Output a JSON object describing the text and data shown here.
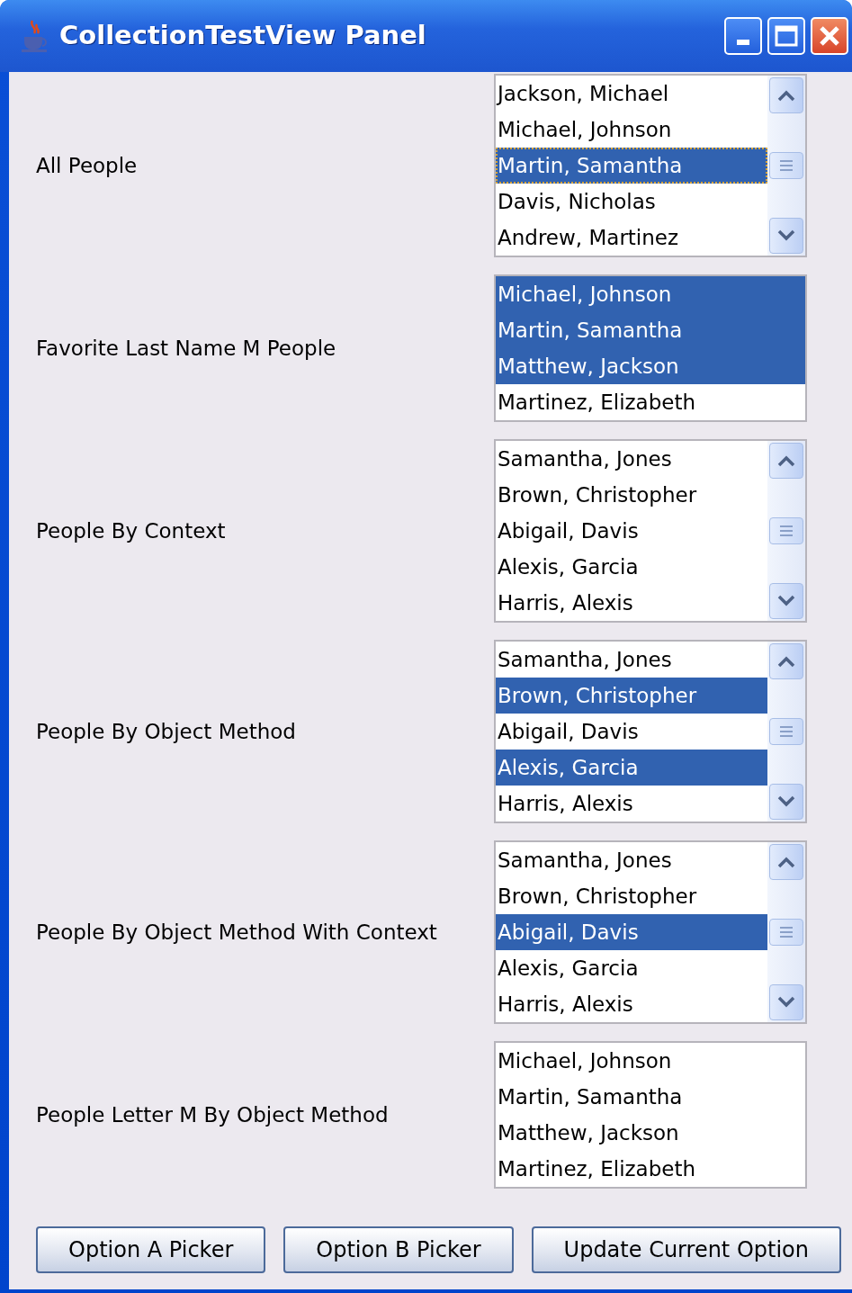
{
  "window": {
    "title": "CollectionTestView Panel"
  },
  "fields": [
    {
      "label": "All People",
      "scrollable": true,
      "items": [
        {
          "text": "Jackson, Michael",
          "selected": false,
          "focused": false
        },
        {
          "text": "Michael, Johnson",
          "selected": false,
          "focused": false
        },
        {
          "text": "Martin, Samantha",
          "selected": true,
          "focused": true
        },
        {
          "text": "Davis, Nicholas",
          "selected": false,
          "focused": false
        },
        {
          "text": "Andrew, Martinez",
          "selected": false,
          "focused": false
        }
      ]
    },
    {
      "label": "Favorite Last Name M People",
      "scrollable": false,
      "items": [
        {
          "text": "Michael, Johnson",
          "selected": true
        },
        {
          "text": "Martin, Samantha",
          "selected": true
        },
        {
          "text": "Matthew, Jackson",
          "selected": true
        },
        {
          "text": "Martinez, Elizabeth",
          "selected": false
        }
      ]
    },
    {
      "label": "People By Context",
      "scrollable": true,
      "items": [
        {
          "text": "Samantha, Jones",
          "selected": false
        },
        {
          "text": "Brown, Christopher",
          "selected": false
        },
        {
          "text": "Abigail, Davis",
          "selected": false
        },
        {
          "text": "Alexis, Garcia",
          "selected": false
        },
        {
          "text": "Harris, Alexis",
          "selected": false
        }
      ]
    },
    {
      "label": "People By Object Method",
      "scrollable": true,
      "items": [
        {
          "text": "Samantha, Jones",
          "selected": false
        },
        {
          "text": "Brown, Christopher",
          "selected": true
        },
        {
          "text": "Abigail, Davis",
          "selected": false
        },
        {
          "text": "Alexis, Garcia",
          "selected": true
        },
        {
          "text": "Harris, Alexis",
          "selected": false
        }
      ]
    },
    {
      "label": "People By Object Method With Context",
      "scrollable": true,
      "items": [
        {
          "text": "Samantha, Jones",
          "selected": false
        },
        {
          "text": "Brown, Christopher",
          "selected": false
        },
        {
          "text": "Abigail, Davis",
          "selected": true
        },
        {
          "text": "Alexis, Garcia",
          "selected": false
        },
        {
          "text": "Harris, Alexis",
          "selected": false
        }
      ]
    },
    {
      "label": "People Letter M By Object Method",
      "scrollable": false,
      "items": [
        {
          "text": "Michael, Johnson",
          "selected": false
        },
        {
          "text": "Martin, Samantha",
          "selected": false
        },
        {
          "text": "Matthew, Jackson",
          "selected": false
        },
        {
          "text": "Martinez, Elizabeth",
          "selected": false
        }
      ]
    }
  ],
  "buttons": [
    "Option A Picker",
    "Option B Picker",
    "Update Current Option"
  ]
}
